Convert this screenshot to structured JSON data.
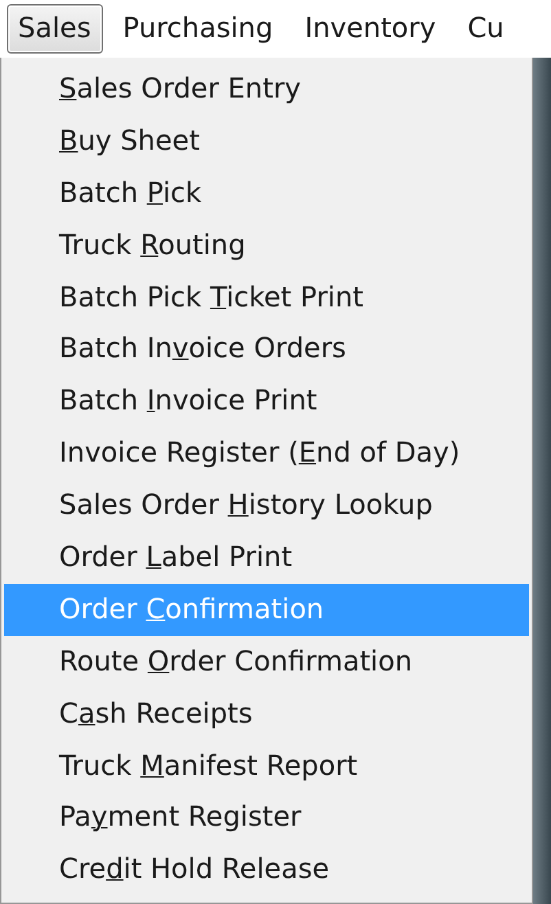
{
  "menu_bar": [
    {
      "label": "Sales",
      "selected": true
    },
    {
      "label": "Purchasing",
      "selected": false
    },
    {
      "label": "Inventory",
      "selected": false
    },
    {
      "label": "Cu",
      "selected": false
    }
  ],
  "menu": {
    "items": [
      {
        "key": "S",
        "after": "ales Order Entry",
        "selected": false
      },
      {
        "key": "B",
        "after": "uy Sheet",
        "selected": false
      },
      {
        "before": "Batch ",
        "key": "P",
        "after": "ick",
        "selected": false
      },
      {
        "before": "Truck ",
        "key": "R",
        "after": "outing",
        "selected": false
      },
      {
        "before": "Batch Pick ",
        "key": "T",
        "after": "icket Print",
        "selected": false
      },
      {
        "before": "Batch In",
        "key": "v",
        "after": "oice Orders",
        "selected": false
      },
      {
        "before": "Batch ",
        "key": "I",
        "after": "nvoice Print",
        "selected": false
      },
      {
        "before": "Invoice Register (",
        "key": "E",
        "after": "nd of Day)",
        "selected": false
      },
      {
        "before": "Sales Order ",
        "key": "H",
        "after": "istory Lookup",
        "selected": false
      },
      {
        "before": "Order ",
        "key": "L",
        "after": "abel Print",
        "selected": false
      },
      {
        "before": "Order ",
        "key": "C",
        "after": "onfirmation",
        "selected": true
      },
      {
        "before": "Route ",
        "key": "O",
        "after": "rder Confirmation",
        "selected": false
      },
      {
        "before": "C",
        "key": "a",
        "after": "sh Receipts",
        "selected": false
      },
      {
        "before": "Truck ",
        "key": "M",
        "after": "anifest Report",
        "selected": false
      },
      {
        "before": "Pa",
        "key": "y",
        "after": "ment Register",
        "selected": false
      },
      {
        "before": "Cre",
        "key": "d",
        "after": "it Hold Release",
        "selected": false
      }
    ]
  }
}
